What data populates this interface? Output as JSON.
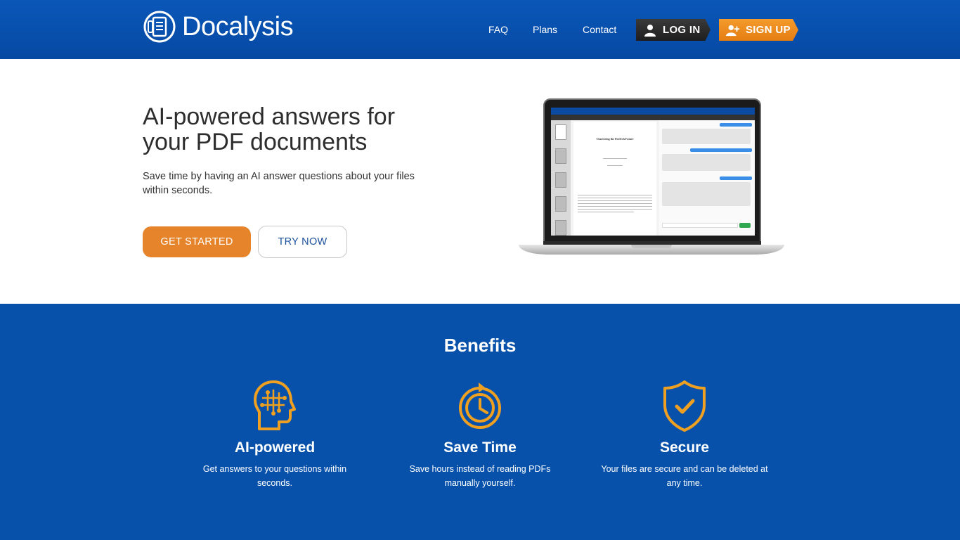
{
  "header": {
    "logo_text": "Docalysis",
    "nav": [
      "FAQ",
      "Plans",
      "Contact"
    ],
    "login_label": "LOG IN",
    "signup_label": "SIGN UP"
  },
  "hero": {
    "title": "AI-powered answers for your PDF documents",
    "subtitle": "Save time by having an AI answer questions about your files within seconds.",
    "primary_button": "GET STARTED",
    "secondary_button": "TRY NOW",
    "screenshot_doc_title": "Chartering the FinTech Future"
  },
  "benefits": {
    "title": "Benefits",
    "items": [
      {
        "icon": "ai-head-icon",
        "title": "AI-powered",
        "text": "Get answers to your questions within seconds."
      },
      {
        "icon": "stopwatch-icon",
        "title": "Save Time",
        "text": "Save hours instead of reading PDFs manually yourself."
      },
      {
        "icon": "shield-check-icon",
        "title": "Secure",
        "text": "Your files are secure and can be deleted at any time."
      }
    ]
  },
  "colors": {
    "header_blue": "#0649a3",
    "benefits_blue": "#0751ab",
    "accent_orange": "#e5842a",
    "icon_orange": "#f0a020"
  }
}
